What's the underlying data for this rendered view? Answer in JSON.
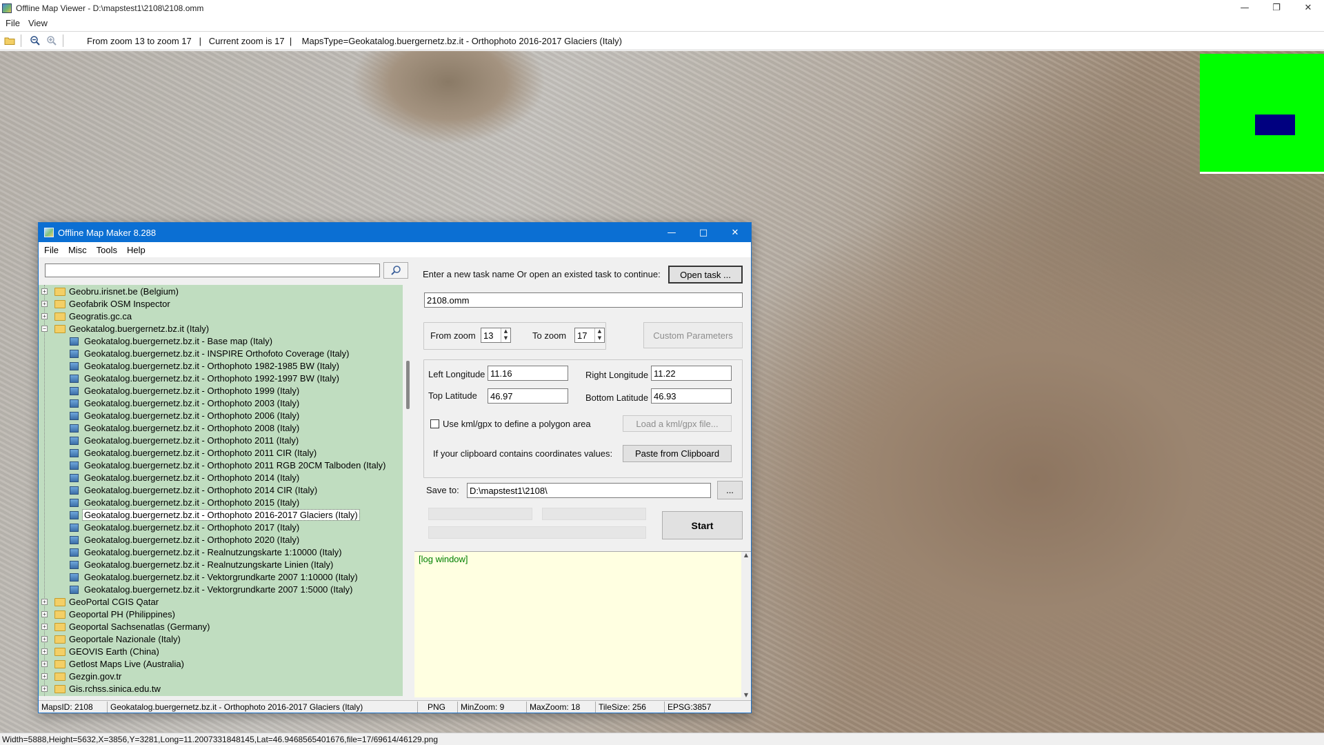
{
  "viewer": {
    "title": "Offline Map Viewer - D:\\mapstest1\\2108\\2108.omm",
    "menu": [
      "File",
      "View"
    ],
    "toolbar_info": "From zoom 13 to zoom 17   |   Current zoom is 17  |    MapsType=Geokatalog.buergernetz.bz.it - Orthophoto 2016-2017 Glaciers (Italy)",
    "statusbar": "Width=5888,Height=5632,X=3856,Y=3281,Long=11.2007331848145,Lat=46.9468565401676,file=17/69614/46129.png",
    "minimap_colors": {
      "background": "#00ff00",
      "viewport": "#000080"
    }
  },
  "omm": {
    "title": "Offline Map Maker 8.288",
    "menu": [
      "File",
      "Misc",
      "Tools",
      "Help"
    ],
    "search": {
      "value": ""
    },
    "tree": [
      {
        "level": 0,
        "type": "folder",
        "expanded": false,
        "label": "Geobru.irisnet.be (Belgium)"
      },
      {
        "level": 0,
        "type": "folder",
        "expanded": false,
        "label": "Geofabrik OSM Inspector"
      },
      {
        "level": 0,
        "type": "folder",
        "expanded": false,
        "label": "Geogratis.gc.ca"
      },
      {
        "level": 0,
        "type": "folder",
        "expanded": true,
        "label": "Geokatalog.buergernetz.bz.it (Italy)"
      },
      {
        "level": 1,
        "type": "map",
        "label": "Geokatalog.buergernetz.bz.it - Base map (Italy)"
      },
      {
        "level": 1,
        "type": "map",
        "label": "Geokatalog.buergernetz.bz.it - INSPIRE Orthofoto Coverage (Italy)"
      },
      {
        "level": 1,
        "type": "map",
        "label": "Geokatalog.buergernetz.bz.it - Orthophoto 1982-1985 BW (Italy)"
      },
      {
        "level": 1,
        "type": "map",
        "label": "Geokatalog.buergernetz.bz.it - Orthophoto 1992-1997 BW (Italy)"
      },
      {
        "level": 1,
        "type": "map",
        "label": "Geokatalog.buergernetz.bz.it - Orthophoto 1999 (Italy)"
      },
      {
        "level": 1,
        "type": "map",
        "label": "Geokatalog.buergernetz.bz.it - Orthophoto 2003 (Italy)"
      },
      {
        "level": 1,
        "type": "map",
        "label": "Geokatalog.buergernetz.bz.it - Orthophoto 2006 (Italy)"
      },
      {
        "level": 1,
        "type": "map",
        "label": "Geokatalog.buergernetz.bz.it - Orthophoto 2008 (Italy)"
      },
      {
        "level": 1,
        "type": "map",
        "label": "Geokatalog.buergernetz.bz.it - Orthophoto 2011 (Italy)"
      },
      {
        "level": 1,
        "type": "map",
        "label": "Geokatalog.buergernetz.bz.it - Orthophoto 2011 CIR (Italy)"
      },
      {
        "level": 1,
        "type": "map",
        "label": "Geokatalog.buergernetz.bz.it - Orthophoto 2011 RGB 20CM Talboden (Italy)"
      },
      {
        "level": 1,
        "type": "map",
        "label": "Geokatalog.buergernetz.bz.it - Orthophoto 2014 (Italy)"
      },
      {
        "level": 1,
        "type": "map",
        "label": "Geokatalog.buergernetz.bz.it - Orthophoto 2014 CIR (Italy)"
      },
      {
        "level": 1,
        "type": "map",
        "label": "Geokatalog.buergernetz.bz.it - Orthophoto 2015 (Italy)"
      },
      {
        "level": 1,
        "type": "map",
        "label": "Geokatalog.buergernetz.bz.it - Orthophoto 2016-2017 Glaciers (Italy)",
        "selected": true
      },
      {
        "level": 1,
        "type": "map",
        "label": "Geokatalog.buergernetz.bz.it - Orthophoto 2017 (Italy)"
      },
      {
        "level": 1,
        "type": "map",
        "label": "Geokatalog.buergernetz.bz.it - Orthophoto 2020 (Italy)"
      },
      {
        "level": 1,
        "type": "map",
        "label": "Geokatalog.buergernetz.bz.it - Realnutzungskarte 1:10000 (Italy)"
      },
      {
        "level": 1,
        "type": "map",
        "label": "Geokatalog.buergernetz.bz.it - Realnutzungskarte Linien (Italy)"
      },
      {
        "level": 1,
        "type": "map",
        "label": "Geokatalog.buergernetz.bz.it - Vektorgrundkarte 2007 1:10000 (Italy)"
      },
      {
        "level": 1,
        "type": "map",
        "label": "Geokatalog.buergernetz.bz.it - Vektorgrundkarte 2007 1:5000 (Italy)"
      },
      {
        "level": 0,
        "type": "folder",
        "expanded": false,
        "label": "GeoPortal CGIS Qatar"
      },
      {
        "level": 0,
        "type": "folder",
        "expanded": false,
        "label": "Geoportal PH (Philippines)"
      },
      {
        "level": 0,
        "type": "folder",
        "expanded": false,
        "label": "Geoportal Sachsenatlas (Germany)"
      },
      {
        "level": 0,
        "type": "folder",
        "expanded": false,
        "label": "Geoportale Nazionale (Italy)"
      },
      {
        "level": 0,
        "type": "folder",
        "expanded": false,
        "label": "GEOVIS Earth (China)"
      },
      {
        "level": 0,
        "type": "folder",
        "expanded": false,
        "label": "Getlost Maps Live (Australia)"
      },
      {
        "level": 0,
        "type": "folder",
        "expanded": false,
        "label": "Gezgin.gov.tr"
      },
      {
        "level": 0,
        "type": "folder",
        "expanded": false,
        "label": "Gis.rchss.sinica.edu.tw"
      }
    ],
    "form": {
      "task_prompt": "Enter a new task name Or open an existed task to continue:",
      "open_task_label": "Open task ...",
      "task_name": "2108.omm",
      "from_zoom_label": "From zoom",
      "from_zoom": "13",
      "to_zoom_label": "To zoom",
      "to_zoom": "17",
      "custom_params_label": "Custom Parameters",
      "left_lon_label": "Left Longitude",
      "left_lon": "11.16",
      "right_lon_label": "Right Longitude",
      "right_lon": "11.22",
      "top_lat_label": "Top Latitude",
      "top_lat": "46.97",
      "bottom_lat_label": "Bottom Latitude",
      "bottom_lat": "46.93",
      "kml_check_label": "Use kml/gpx to define a polygon area",
      "kml_checked": false,
      "load_kml_label": "Load a kml/gpx file...",
      "clipboard_prompt": "If your clipboard contains coordinates values:",
      "paste_label": "Paste from Clipboard",
      "save_to_label": "Save to:",
      "save_to": "D:\\mapstest1\\2108\\",
      "browse_label": "...",
      "start_label": "Start",
      "log_text": "[log window]"
    },
    "statusbar": {
      "maps_id": "MapsID: 2108",
      "maps_name": "Geokatalog.buergernetz.bz.it - Orthophoto 2016-2017 Glaciers (Italy)",
      "format": "PNG",
      "min_zoom": "MinZoom: 9",
      "max_zoom": "MaxZoom: 18",
      "tile_size": "TileSize: 256",
      "epsg": "EPSG:3857"
    }
  }
}
